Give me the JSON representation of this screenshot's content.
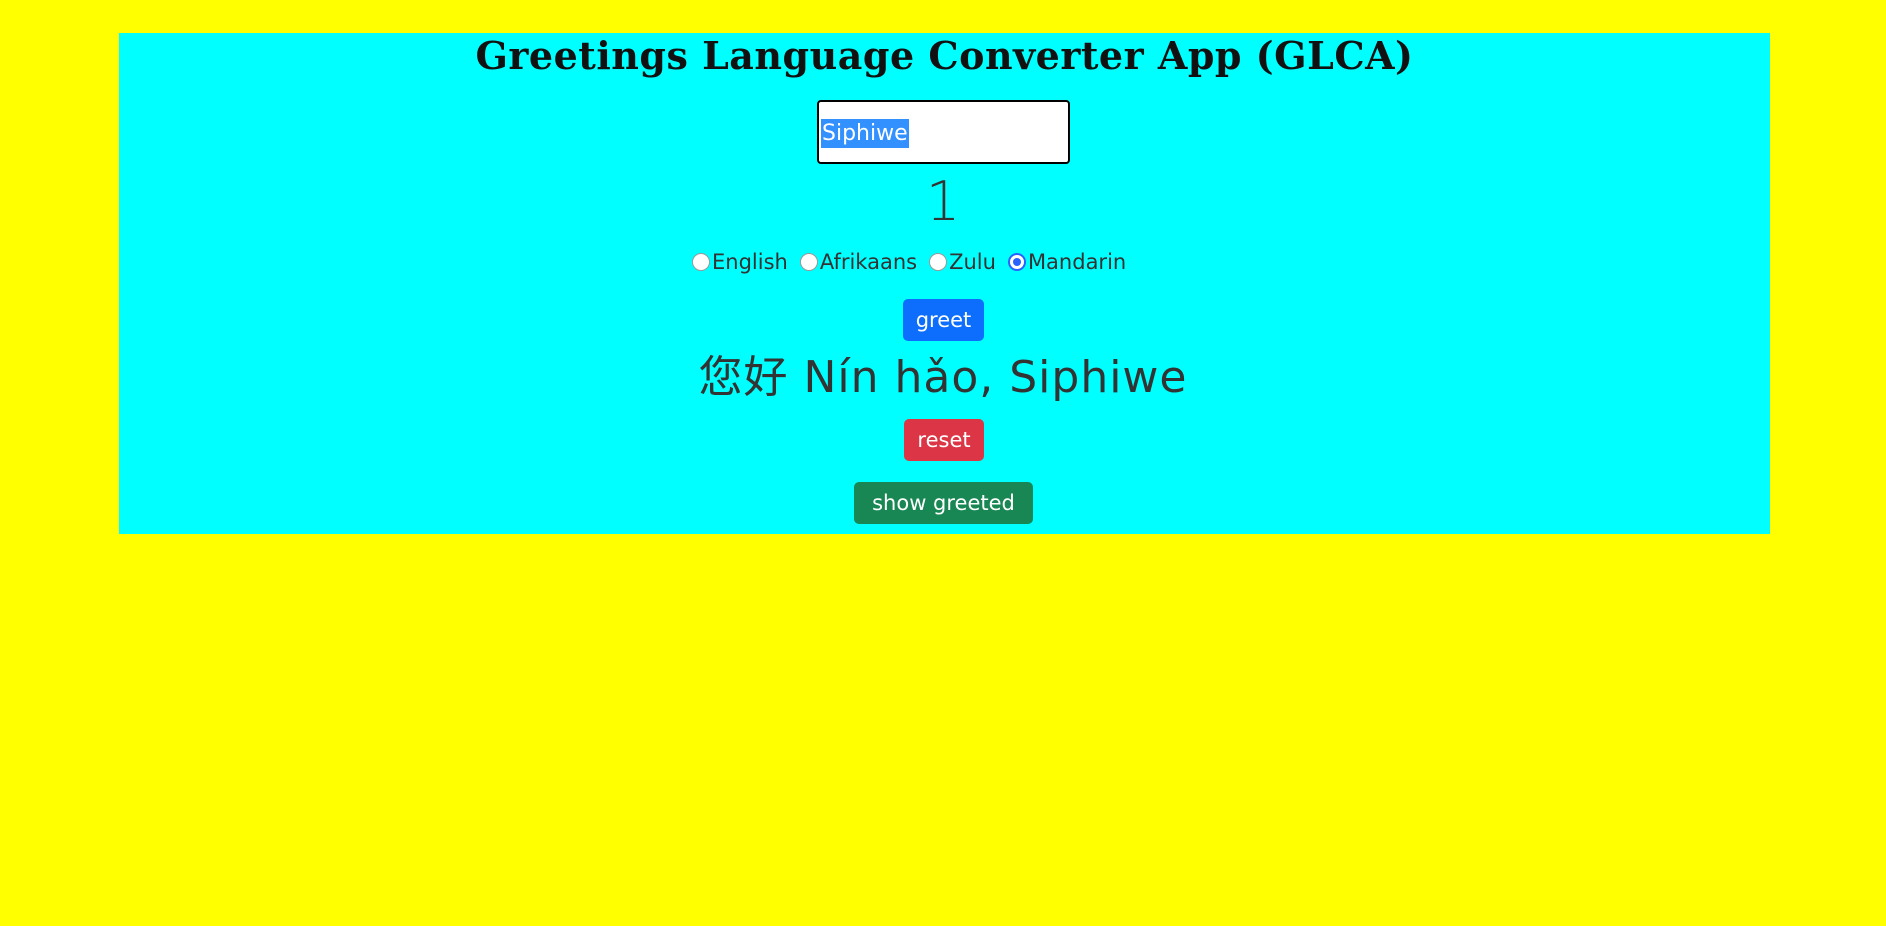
{
  "app": {
    "title": "Greetings Language Converter App (GLCA)"
  },
  "name_input": {
    "value": "Siphiwe"
  },
  "counter": "1",
  "languages": [
    {
      "label": "English",
      "checked": false
    },
    {
      "label": "Afrikaans",
      "checked": false
    },
    {
      "label": "Zulu",
      "checked": false
    },
    {
      "label": "Mandarin",
      "checked": true
    }
  ],
  "buttons": {
    "greet": "greet",
    "reset": "reset",
    "show_greeted": "show greeted"
  },
  "greeting_message": "您好 Nín hǎo, Siphiwe",
  "colors": {
    "page_background": "#ffff00",
    "panel_background": "#00ffff",
    "greet_button": "#0d6efd",
    "reset_button": "#dc3545",
    "show_greeted_button": "#198754"
  }
}
